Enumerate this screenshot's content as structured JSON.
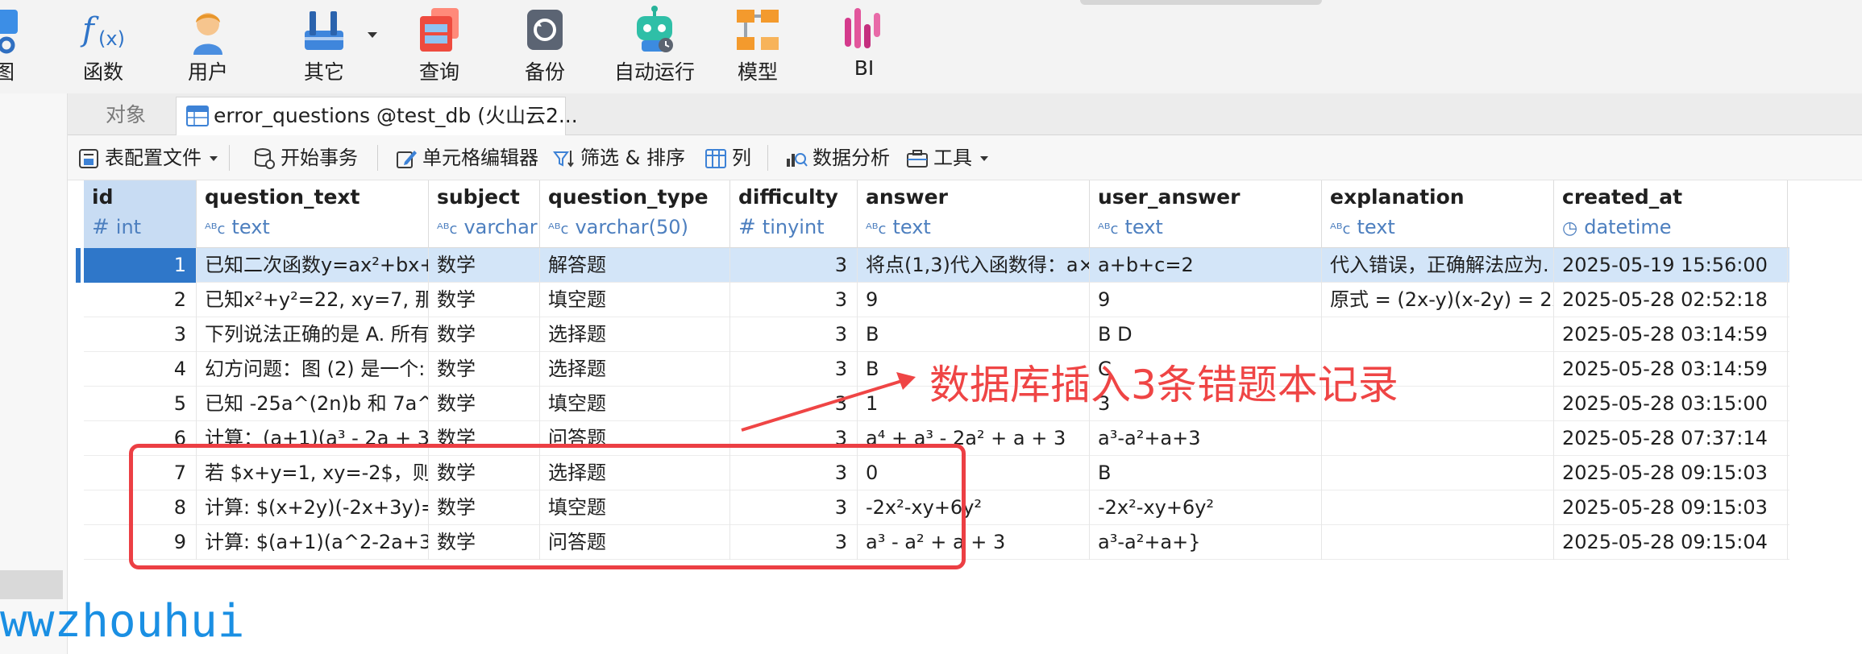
{
  "toolbar": {
    "items": [
      {
        "label": "图",
        "icon": "view-icon"
      },
      {
        "label": "函数",
        "icon": "function-icon"
      },
      {
        "label": "用户",
        "icon": "user-icon"
      },
      {
        "label": "其它",
        "icon": "tools-icon"
      },
      {
        "label": "查询",
        "icon": "query-icon"
      },
      {
        "label": "备份",
        "icon": "backup-icon"
      },
      {
        "label": "自动运行",
        "icon": "robot-icon"
      },
      {
        "label": "模型",
        "icon": "model-icon"
      },
      {
        "label": "BI",
        "icon": "bi-icon"
      }
    ]
  },
  "tabs": {
    "objects": "对象",
    "active": "error_questions @test_db (火山云2..."
  },
  "subtoolbar": {
    "table_profile": "表配置文件",
    "begin_transaction": "开始事务",
    "cell_editor": "单元格编辑器",
    "filter_sort": "筛选 & 排序",
    "columns": "列",
    "data_analysis": "数据分析",
    "tools": "工具"
  },
  "grid": {
    "columns": [
      {
        "name": "id",
        "type": "int",
        "type_icon": "#"
      },
      {
        "name": "question_text",
        "type": "text",
        "type_icon": "ABC"
      },
      {
        "name": "subject",
        "type": "varchar",
        "type_icon": "ABC"
      },
      {
        "name": "question_type",
        "type": "varchar(50)",
        "type_icon": "ABC"
      },
      {
        "name": "difficulty",
        "type": "tinyint",
        "type_icon": "#"
      },
      {
        "name": "answer",
        "type": "text",
        "type_icon": "ABC"
      },
      {
        "name": "user_answer",
        "type": "text",
        "type_icon": "ABC"
      },
      {
        "name": "explanation",
        "type": "text",
        "type_icon": "ABC"
      },
      {
        "name": "created_at",
        "type": "datetime",
        "type_icon": "clock"
      }
    ],
    "rows": [
      {
        "id": "1",
        "question_text": "已知二次函数y=ax²+bx+",
        "subject": "数学",
        "question_type": "解答题",
        "difficulty": "3",
        "answer": "将点(1,3)代入函数得：a×",
        "user_answer": "a+b+c=2",
        "explanation": "代入错误，正确解法应为.",
        "created_at": "2025-05-19 15:56:00"
      },
      {
        "id": "2",
        "question_text": "已知x²+y²=22, xy=7, 那:",
        "subject": "数学",
        "question_type": "填空题",
        "difficulty": "3",
        "answer": "9",
        "user_answer": "9",
        "explanation": "原式 = (2x-y)(x-2y) = 2x",
        "created_at": "2025-05-28 02:52:18"
      },
      {
        "id": "3",
        "question_text": "下列说法正确的是 A. 所有",
        "subject": "数学",
        "question_type": "选择题",
        "difficulty": "3",
        "answer": "B",
        "user_answer": "B D",
        "explanation": "",
        "created_at": "2025-05-28 03:14:59"
      },
      {
        "id": "4",
        "question_text": "幻方问题：图 (2) 是一个:",
        "subject": "数学",
        "question_type": "选择题",
        "difficulty": "3",
        "answer": "B",
        "user_answer": "C",
        "explanation": "",
        "created_at": "2025-05-28 03:14:59"
      },
      {
        "id": "5",
        "question_text": "已知 -25a^(2n)b 和 7a^",
        "subject": "数学",
        "question_type": "填空题",
        "difficulty": "3",
        "answer": "1",
        "user_answer": "3",
        "explanation": "",
        "created_at": "2025-05-28 03:15:00"
      },
      {
        "id": "6",
        "question_text": "计算：(a+1)(a³ - 2a + 3)",
        "subject": "数学",
        "question_type": "问答题",
        "difficulty": "3",
        "answer": "a⁴ + a³ - 2a² + a + 3",
        "user_answer": "a³-a²+a+3",
        "explanation": "",
        "created_at": "2025-05-28 07:37:14"
      },
      {
        "id": "7",
        "question_text": "若 $x+y=1, xy=-2$，则",
        "subject": "数学",
        "question_type": "选择题",
        "difficulty": "3",
        "answer": "0",
        "user_answer": "B",
        "explanation": "",
        "created_at": "2025-05-28 09:15:03"
      },
      {
        "id": "8",
        "question_text": "计算: $(x+2y)(-2x+3y)=!",
        "subject": "数学",
        "question_type": "填空题",
        "difficulty": "3",
        "answer": "-2x²-xy+6y²",
        "user_answer": "-2x²-xy+6y²",
        "explanation": "",
        "created_at": "2025-05-28 09:15:03"
      },
      {
        "id": "9",
        "question_text": "计算: $(a+1)(a^2-2a+3)",
        "subject": "数学",
        "question_type": "问答题",
        "difficulty": "3",
        "answer": "a³ - a² + a + 3",
        "user_answer": "a³-a²+a+}",
        "explanation": "",
        "created_at": "2025-05-28 09:15:04"
      }
    ]
  },
  "annotation": {
    "text": "数据库插入3条错题本记录",
    "color": "#ef4545"
  },
  "watermark": "wwzhouhui",
  "colors": {
    "accent": "#2f77c9",
    "selection": "#d3e5f8",
    "annotation_red": "#ec3f44",
    "watermark": "#1a8fe3"
  }
}
